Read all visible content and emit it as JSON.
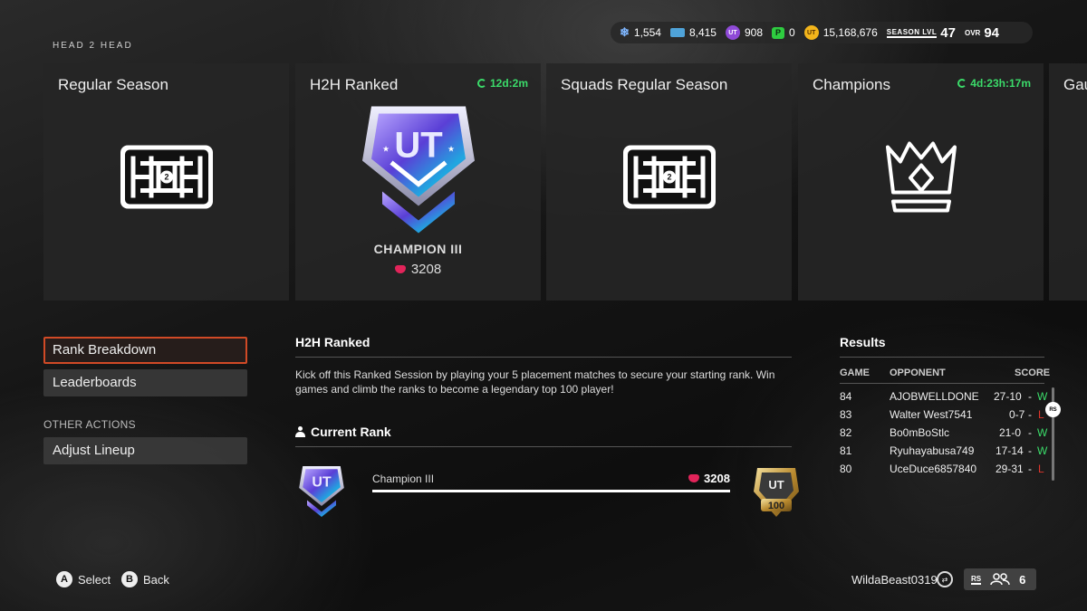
{
  "screen_title": "HEAD 2 HEAD",
  "currencies": [
    {
      "icon": "snowflake-icon",
      "value": "1,554"
    },
    {
      "icon": "ticket-icon",
      "value": "8,415"
    },
    {
      "icon": "ut-points-icon",
      "value": "908"
    },
    {
      "icon": "p-points-icon",
      "value": "0"
    },
    {
      "icon": "coin-icon",
      "value": "15,168,676"
    }
  ],
  "season": {
    "label": "SEASON LVL",
    "value": "47"
  },
  "ovr": {
    "label": "OVR",
    "value": "94"
  },
  "modes": [
    {
      "title": "Regular Season",
      "timer": ""
    },
    {
      "title": "H2H Ranked",
      "timer": "12d:2m",
      "rank_name": "CHAMPION III",
      "points": "3208"
    },
    {
      "title": "Squads Regular Season",
      "timer": ""
    },
    {
      "title": "Champions",
      "timer": "4d:23h:17m"
    },
    {
      "title": "Gau",
      "timer": ""
    }
  ],
  "nav": {
    "rank_breakdown": "Rank Breakdown",
    "leaderboards": "Leaderboards",
    "other_actions": "OTHER ACTIONS",
    "adjust_lineup": "Adjust Lineup"
  },
  "detail": {
    "title": "H2H Ranked",
    "description": "Kick off this Ranked Session by playing your 5 placement matches to secure your starting rank. Win games and climb the ranks to become a legendary top 100 player!",
    "current_rank_label": "Current Rank",
    "rank_name": "Champion III",
    "points": "3208",
    "progress": 1.0,
    "next_badge_label": "100"
  },
  "results": {
    "title": "Results",
    "headers": {
      "game": "GAME",
      "opponent": "OPPONENT",
      "score": "SCORE"
    },
    "rows": [
      {
        "game": "84",
        "opponent": "AJOBWELLDONE",
        "score": "27-10",
        "sep": "-",
        "result": "W"
      },
      {
        "game": "83",
        "opponent": "Walter West7541",
        "score": "0-7",
        "sep": "-",
        "result": "L"
      },
      {
        "game": "82",
        "opponent": "Bo0mBoStlc",
        "score": "21-0",
        "sep": "-",
        "result": "W"
      },
      {
        "game": "81",
        "opponent": "Ryuhayabusa749",
        "score": "17-14",
        "sep": "-",
        "result": "W"
      },
      {
        "game": "80",
        "opponent": "UceDuce6857840",
        "score": "29-31",
        "sep": "-",
        "result": "L"
      }
    ],
    "scroll_label": "RS"
  },
  "footer": {
    "select_btn": "A",
    "select_label": "Select",
    "back_btn": "B",
    "back_label": "Back",
    "gamertag": "WildaBeast0319",
    "rs_label": "RS",
    "party_count": "6"
  },
  "colors": {
    "accent_orange": "#d14a26",
    "timer_green": "#3bdc6a",
    "win_green": "#3bdc6a",
    "loss_red": "#e0352b",
    "points_pink": "#e2245a"
  }
}
